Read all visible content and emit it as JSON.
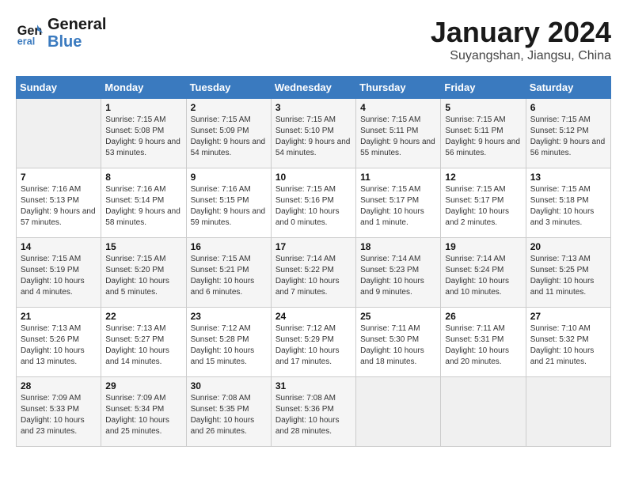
{
  "header": {
    "logo_line1": "General",
    "logo_line2": "Blue",
    "month": "January 2024",
    "location": "Suyangshan, Jiangsu, China"
  },
  "weekdays": [
    "Sunday",
    "Monday",
    "Tuesday",
    "Wednesday",
    "Thursday",
    "Friday",
    "Saturday"
  ],
  "weeks": [
    [
      {
        "day": "",
        "sunrise": "",
        "sunset": "",
        "daylight": ""
      },
      {
        "day": "1",
        "sunrise": "Sunrise: 7:15 AM",
        "sunset": "Sunset: 5:08 PM",
        "daylight": "Daylight: 9 hours and 53 minutes."
      },
      {
        "day": "2",
        "sunrise": "Sunrise: 7:15 AM",
        "sunset": "Sunset: 5:09 PM",
        "daylight": "Daylight: 9 hours and 54 minutes."
      },
      {
        "day": "3",
        "sunrise": "Sunrise: 7:15 AM",
        "sunset": "Sunset: 5:10 PM",
        "daylight": "Daylight: 9 hours and 54 minutes."
      },
      {
        "day": "4",
        "sunrise": "Sunrise: 7:15 AM",
        "sunset": "Sunset: 5:11 PM",
        "daylight": "Daylight: 9 hours and 55 minutes."
      },
      {
        "day": "5",
        "sunrise": "Sunrise: 7:15 AM",
        "sunset": "Sunset: 5:11 PM",
        "daylight": "Daylight: 9 hours and 56 minutes."
      },
      {
        "day": "6",
        "sunrise": "Sunrise: 7:15 AM",
        "sunset": "Sunset: 5:12 PM",
        "daylight": "Daylight: 9 hours and 56 minutes."
      }
    ],
    [
      {
        "day": "7",
        "sunrise": "Sunrise: 7:16 AM",
        "sunset": "Sunset: 5:13 PM",
        "daylight": "Daylight: 9 hours and 57 minutes."
      },
      {
        "day": "8",
        "sunrise": "Sunrise: 7:16 AM",
        "sunset": "Sunset: 5:14 PM",
        "daylight": "Daylight: 9 hours and 58 minutes."
      },
      {
        "day": "9",
        "sunrise": "Sunrise: 7:16 AM",
        "sunset": "Sunset: 5:15 PM",
        "daylight": "Daylight: 9 hours and 59 minutes."
      },
      {
        "day": "10",
        "sunrise": "Sunrise: 7:15 AM",
        "sunset": "Sunset: 5:16 PM",
        "daylight": "Daylight: 10 hours and 0 minutes."
      },
      {
        "day": "11",
        "sunrise": "Sunrise: 7:15 AM",
        "sunset": "Sunset: 5:17 PM",
        "daylight": "Daylight: 10 hours and 1 minute."
      },
      {
        "day": "12",
        "sunrise": "Sunrise: 7:15 AM",
        "sunset": "Sunset: 5:17 PM",
        "daylight": "Daylight: 10 hours and 2 minutes."
      },
      {
        "day": "13",
        "sunrise": "Sunrise: 7:15 AM",
        "sunset": "Sunset: 5:18 PM",
        "daylight": "Daylight: 10 hours and 3 minutes."
      }
    ],
    [
      {
        "day": "14",
        "sunrise": "Sunrise: 7:15 AM",
        "sunset": "Sunset: 5:19 PM",
        "daylight": "Daylight: 10 hours and 4 minutes."
      },
      {
        "day": "15",
        "sunrise": "Sunrise: 7:15 AM",
        "sunset": "Sunset: 5:20 PM",
        "daylight": "Daylight: 10 hours and 5 minutes."
      },
      {
        "day": "16",
        "sunrise": "Sunrise: 7:15 AM",
        "sunset": "Sunset: 5:21 PM",
        "daylight": "Daylight: 10 hours and 6 minutes."
      },
      {
        "day": "17",
        "sunrise": "Sunrise: 7:14 AM",
        "sunset": "Sunset: 5:22 PM",
        "daylight": "Daylight: 10 hours and 7 minutes."
      },
      {
        "day": "18",
        "sunrise": "Sunrise: 7:14 AM",
        "sunset": "Sunset: 5:23 PM",
        "daylight": "Daylight: 10 hours and 9 minutes."
      },
      {
        "day": "19",
        "sunrise": "Sunrise: 7:14 AM",
        "sunset": "Sunset: 5:24 PM",
        "daylight": "Daylight: 10 hours and 10 minutes."
      },
      {
        "day": "20",
        "sunrise": "Sunrise: 7:13 AM",
        "sunset": "Sunset: 5:25 PM",
        "daylight": "Daylight: 10 hours and 11 minutes."
      }
    ],
    [
      {
        "day": "21",
        "sunrise": "Sunrise: 7:13 AM",
        "sunset": "Sunset: 5:26 PM",
        "daylight": "Daylight: 10 hours and 13 minutes."
      },
      {
        "day": "22",
        "sunrise": "Sunrise: 7:13 AM",
        "sunset": "Sunset: 5:27 PM",
        "daylight": "Daylight: 10 hours and 14 minutes."
      },
      {
        "day": "23",
        "sunrise": "Sunrise: 7:12 AM",
        "sunset": "Sunset: 5:28 PM",
        "daylight": "Daylight: 10 hours and 15 minutes."
      },
      {
        "day": "24",
        "sunrise": "Sunrise: 7:12 AM",
        "sunset": "Sunset: 5:29 PM",
        "daylight": "Daylight: 10 hours and 17 minutes."
      },
      {
        "day": "25",
        "sunrise": "Sunrise: 7:11 AM",
        "sunset": "Sunset: 5:30 PM",
        "daylight": "Daylight: 10 hours and 18 minutes."
      },
      {
        "day": "26",
        "sunrise": "Sunrise: 7:11 AM",
        "sunset": "Sunset: 5:31 PM",
        "daylight": "Daylight: 10 hours and 20 minutes."
      },
      {
        "day": "27",
        "sunrise": "Sunrise: 7:10 AM",
        "sunset": "Sunset: 5:32 PM",
        "daylight": "Daylight: 10 hours and 21 minutes."
      }
    ],
    [
      {
        "day": "28",
        "sunrise": "Sunrise: 7:09 AM",
        "sunset": "Sunset: 5:33 PM",
        "daylight": "Daylight: 10 hours and 23 minutes."
      },
      {
        "day": "29",
        "sunrise": "Sunrise: 7:09 AM",
        "sunset": "Sunset: 5:34 PM",
        "daylight": "Daylight: 10 hours and 25 minutes."
      },
      {
        "day": "30",
        "sunrise": "Sunrise: 7:08 AM",
        "sunset": "Sunset: 5:35 PM",
        "daylight": "Daylight: 10 hours and 26 minutes."
      },
      {
        "day": "31",
        "sunrise": "Sunrise: 7:08 AM",
        "sunset": "Sunset: 5:36 PM",
        "daylight": "Daylight: 10 hours and 28 minutes."
      },
      {
        "day": "",
        "sunrise": "",
        "sunset": "",
        "daylight": ""
      },
      {
        "day": "",
        "sunrise": "",
        "sunset": "",
        "daylight": ""
      },
      {
        "day": "",
        "sunrise": "",
        "sunset": "",
        "daylight": ""
      }
    ]
  ]
}
